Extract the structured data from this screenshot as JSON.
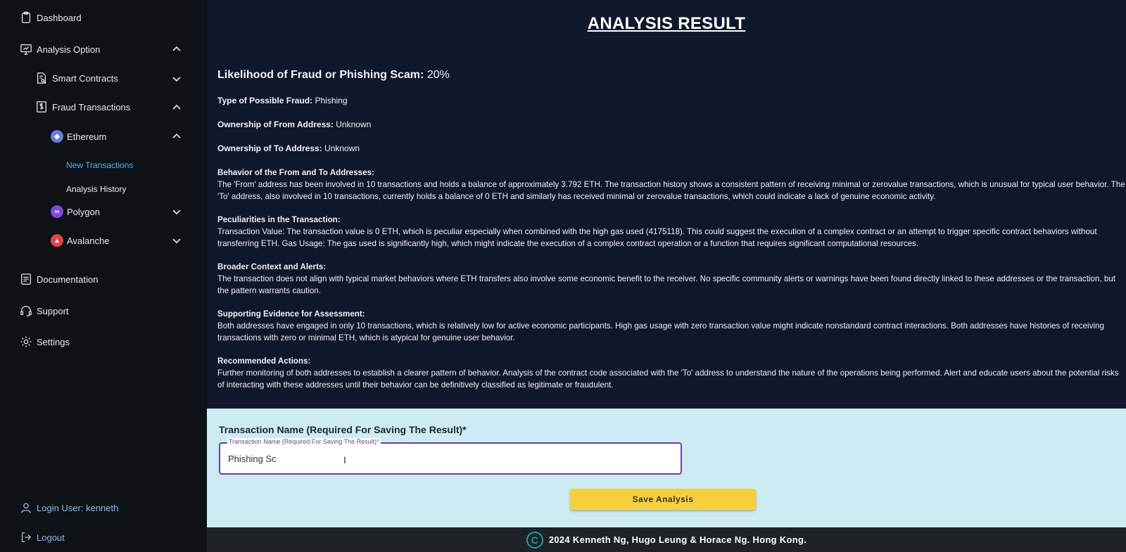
{
  "sidebar": {
    "dashboard": "Dashboard",
    "analysis_option": "Analysis Option",
    "smart_contracts": "Smart Contracts",
    "fraud_transactions": "Fraud Transactions",
    "ethereum": "Ethereum",
    "new_transactions": "New Transactions",
    "analysis_history": "Analysis History",
    "polygon": "Polygon",
    "avalanche": "Avalanche",
    "documentation": "Documentation",
    "support": "Support",
    "settings": "Settings",
    "login_user": "Login User: kenneth",
    "logout": "Logout"
  },
  "result": {
    "title": "ANALYSIS RESULT",
    "likelihood_label": "Likelihood of Fraud or Phishing Scam:",
    "likelihood_value": "20%",
    "type_label": "Type of Possible Fraud:",
    "type_value": "Phishing",
    "from_owner_label": "Ownership of From Address:",
    "from_owner_value": "Unknown",
    "to_owner_label": "Ownership of To Address:",
    "to_owner_value": "Unknown",
    "sections": [
      {
        "heading": "Behavior of the From and To Addresses:",
        "body": "The 'From' address has been involved in 10 transactions and holds a balance of approximately 3.792 ETH. The transaction history shows a consistent pattern of receiving minimal or zerovalue transactions, which is unusual for typical user behavior. The 'To' address, also involved in 10 transactions, currently holds a balance of 0 ETH and similarly has received minimal or zerovalue transactions, which could indicate a lack of genuine economic activity."
      },
      {
        "heading": "Peculiarities in the Transaction:",
        "body": "Transaction Value: The transaction value is 0 ETH, which is peculiar especially when combined with the high gas used (4175118). This could suggest the execution of a complex contract or an attempt to trigger specific contract behaviors without transferring ETH. Gas Usage: The gas used is significantly high, which might indicate the execution of a complex contract operation or a function that requires significant computational resources."
      },
      {
        "heading": "Broader Context and Alerts:",
        "body": "The transaction does not align with typical market behaviors where ETH transfers also involve some economic benefit to the receiver. No specific community alerts or warnings have been found directly linked to these addresses or the transaction, but the pattern warrants caution."
      },
      {
        "heading": "Supporting Evidence for Assessment:",
        "body": "Both addresses have engaged in only 10 transactions, which is relatively low for active economic participants. High gas usage with zero transaction value might indicate nonstandard contract interactions. Both addresses have histories of receiving transactions with zero or minimal ETH, which is atypical for genuine user behavior."
      },
      {
        "heading": "Recommended Actions:",
        "body": "Further monitoring of both addresses to establish a clearer pattern of behavior. Analysis of the contract code associated with the 'To' address to understand the nature of the operations being performed. Alert and educate users about the potential risks of interacting with these addresses until their behavior can be definitively classified as legitimate or fraudulent."
      }
    ]
  },
  "save": {
    "label": "Transaction Name (Required For Saving The Result)*",
    "legend": "Transaction Name (Required For Saving The Result)*",
    "value": "Phishing Sc",
    "button": "Save Analysis"
  },
  "footer": {
    "icon": "C",
    "text": "2024 Kenneth Ng, Hugo Leung & Horace Ng. Hong Kong."
  },
  "colors": {
    "sidebar_bg": "#0e1116",
    "main_bg": "#0f172a",
    "active_link": "#4fb6e8",
    "save_panel_bg": "#cdebf3",
    "save_button": "#f7cf3a",
    "input_border": "#6b3fa8",
    "footer_bg": "#1e2226",
    "ethereum": "#627eea",
    "polygon": "#8247e5",
    "avalanche": "#e84142"
  }
}
